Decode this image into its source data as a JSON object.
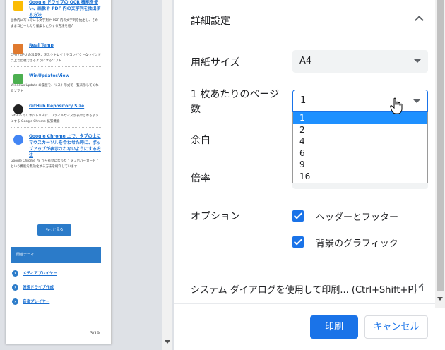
{
  "preview": {
    "items": [
      {
        "title": "Google ドライブの OCR 機能を使い、画像や PDF 内の文字列を抽出する方法",
        "desc": "画像内に写っている文字列や PDF 内の文字列を抽出し、そのままコピーしたり編集したりする方法を紹介",
        "icon_color": "#fbbc05"
      },
      {
        "title": "Real Temp",
        "desc": "CPU / GPU の温度を、タスクトレイ上やコンパクトなウインドウ上で監視できるようにするソフト",
        "icon_color": "#e07a2f"
      },
      {
        "title": "WinUpdatesView",
        "desc": "Windows Update の履歴を、リスト形式で一覧表示してくれるソフト",
        "icon_color": "#4caf50"
      },
      {
        "title": "GitHub Repository Size",
        "desc": "GitHub のリポジトリ内に、ファイルサイズが表示されるようにする Google Chrome 拡張機能",
        "icon_color": "#222222"
      },
      {
        "title": "Google Chrome 上で、タブの上にマウスカーソルを合わせた時に、ポップアップが表示されないようにする方法",
        "desc": "Google Chrome 78 から有効になった \" タブホバーカード \" という機能を無効化する方法を紹介しています",
        "icon_color": "#4285f4"
      }
    ],
    "more_label": "もっと見る",
    "theme_label": "関連テーマ",
    "links": [
      "メディアプレイヤー",
      "仮想ドライブ作成",
      "音楽プレイヤー"
    ],
    "page_number": "3/19"
  },
  "settings": {
    "section_title": "詳細設定",
    "paper_size_label": "用紙サイズ",
    "paper_size_value": "A4",
    "pages_per_sheet_label_1": "1 枚あたりのページ",
    "pages_per_sheet_label_2": "数",
    "pages_per_sheet_value": "1",
    "pages_per_sheet_options": [
      "1",
      "2",
      "4",
      "6",
      "9",
      "16"
    ],
    "margin_label": "余白",
    "scale_label": "倍率",
    "options_label": "オプション",
    "option_headers_footers": "ヘッダーとフッター",
    "option_background_graphics": "背景のグラフィック",
    "system_dialog_label": "システム ダイアログを使用して印刷... (Ctrl+Shift+P)",
    "print_button": "印刷",
    "cancel_button": "キャンセル"
  },
  "colors": {
    "accent": "#1a73e8",
    "selected_option": "#1e90ff"
  }
}
